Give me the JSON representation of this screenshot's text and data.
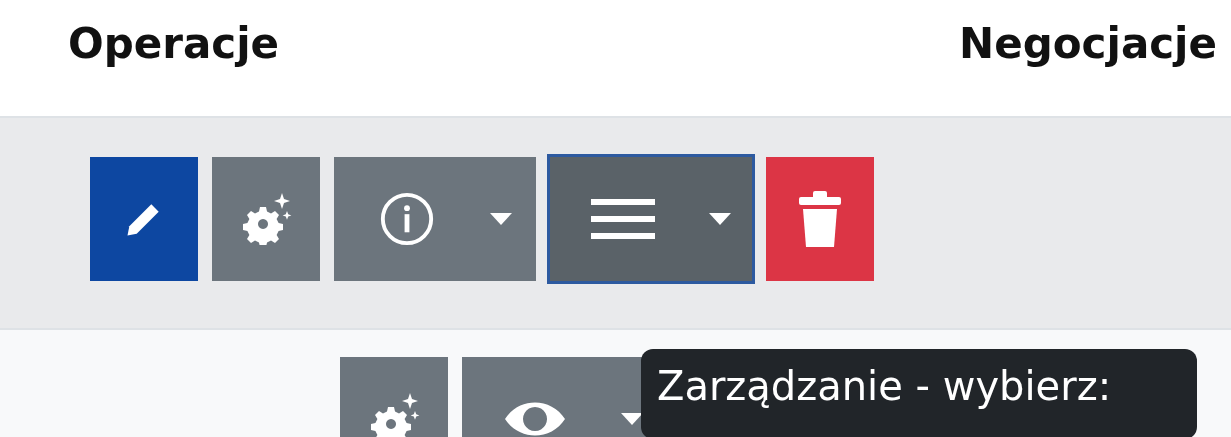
{
  "table": {
    "columns": [
      {
        "label": "Operacje"
      },
      {
        "label": "Negocjacje"
      }
    ],
    "rows": [
      {
        "buttons": [
          {
            "kind": "edit",
            "focused": false
          },
          {
            "kind": "settings",
            "focused": false
          },
          {
            "kind": "info",
            "focused": false
          },
          {
            "kind": "menu",
            "focused": true
          },
          {
            "kind": "delete",
            "focused": false
          }
        ]
      },
      {
        "buttons": [
          {
            "kind": "settings",
            "focused": false
          },
          {
            "kind": "view",
            "focused": false
          }
        ]
      }
    ]
  },
  "tooltip": {
    "text": "Zarządzanie - wybierz:"
  }
}
